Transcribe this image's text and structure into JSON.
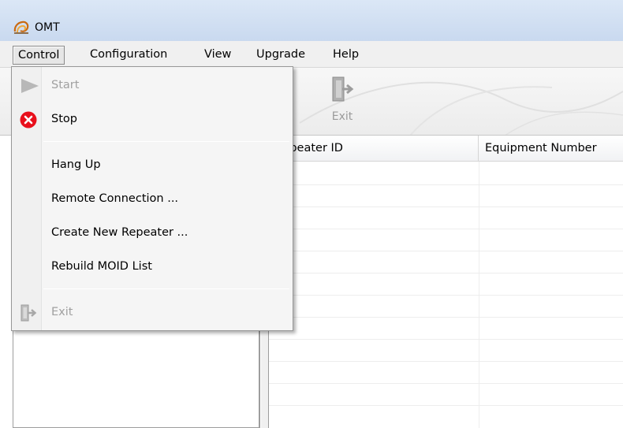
{
  "window": {
    "title": "OMT",
    "app_icon": "omt-logo-icon"
  },
  "menubar": {
    "items": [
      {
        "label": "Control",
        "active": true
      },
      {
        "label": "Configuration"
      },
      {
        "label": "View"
      },
      {
        "label": "Upgrade"
      },
      {
        "label": "Help"
      }
    ]
  },
  "toolbar": {
    "exit": {
      "label": "Exit",
      "icon": "exit-door-icon",
      "enabled": false
    }
  },
  "grid": {
    "columns": [
      {
        "label": "Repeater ID"
      },
      {
        "label": "Equipment Number"
      }
    ]
  },
  "control_menu": {
    "items": [
      {
        "label": "Start",
        "icon": "play-icon",
        "enabled": false
      },
      {
        "label": "Stop",
        "icon": "stop-red-x-icon",
        "enabled": true
      },
      {
        "label": "Hang Up",
        "enabled": true
      },
      {
        "label": "Remote Connection ...",
        "enabled": true
      },
      {
        "label": "Create New Repeater ...",
        "enabled": true
      },
      {
        "label": "Rebuild MOID List",
        "enabled": true
      },
      {
        "label": "Exit",
        "icon": "exit-door-icon",
        "enabled": false
      }
    ]
  },
  "colors": {
    "titlebar": "#dbe7f6",
    "stop_red": "#e8101c",
    "disabled_text": "#a0a0a0"
  }
}
